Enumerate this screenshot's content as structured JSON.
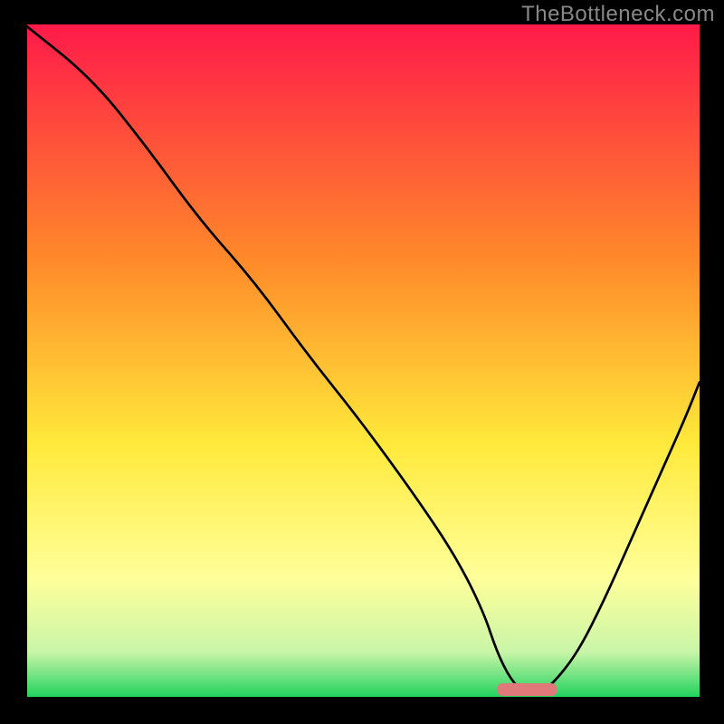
{
  "watermark": "TheBottleneck.com",
  "colors": {
    "top_red": "#ff1a4a",
    "orange": "#ff8a2a",
    "yellow": "#ffe93a",
    "pale_yellow": "#ffff9a",
    "pale_green": "#c8f5a8",
    "green": "#18d05a",
    "marker": "#e07a7a",
    "line": "#000000"
  },
  "marker": {
    "x_frac_start": 0.7,
    "x_frac_end": 0.79,
    "y_frac": 0.985
  },
  "chart_data": {
    "type": "line",
    "title": "",
    "xlabel": "",
    "ylabel": "",
    "xlim": [
      0,
      100
    ],
    "ylim": [
      0,
      100
    ],
    "note": "No numeric axis ticks or labels are visible; values below are fractional positions (0–100) estimated from pixel geometry. High y = top of plot. The curve is a V-like shape with vertex near the green marker at x≈74.",
    "series": [
      {
        "name": "curve",
        "x": [
          0,
          10,
          18,
          26,
          34,
          42,
          50,
          58,
          64,
          68,
          70,
          72,
          74,
          76,
          78,
          82,
          86,
          90,
          94,
          98,
          100
        ],
        "y": [
          100,
          92,
          82,
          71,
          62,
          51,
          41,
          30,
          21,
          13,
          7,
          3,
          1,
          1,
          2,
          7,
          15,
          24,
          33,
          42,
          47
        ]
      }
    ],
    "marker_region": {
      "x_start": 70,
      "x_end": 79,
      "y": 1
    },
    "background_gradient_stops": [
      {
        "pos": 0.0,
        "color": "#ff1a4a"
      },
      {
        "pos": 0.35,
        "color": "#ff8a2a"
      },
      {
        "pos": 0.62,
        "color": "#ffe93a"
      },
      {
        "pos": 0.82,
        "color": "#ffff9a"
      },
      {
        "pos": 0.93,
        "color": "#c8f5a8"
      },
      {
        "pos": 1.0,
        "color": "#18d05a"
      }
    ]
  }
}
